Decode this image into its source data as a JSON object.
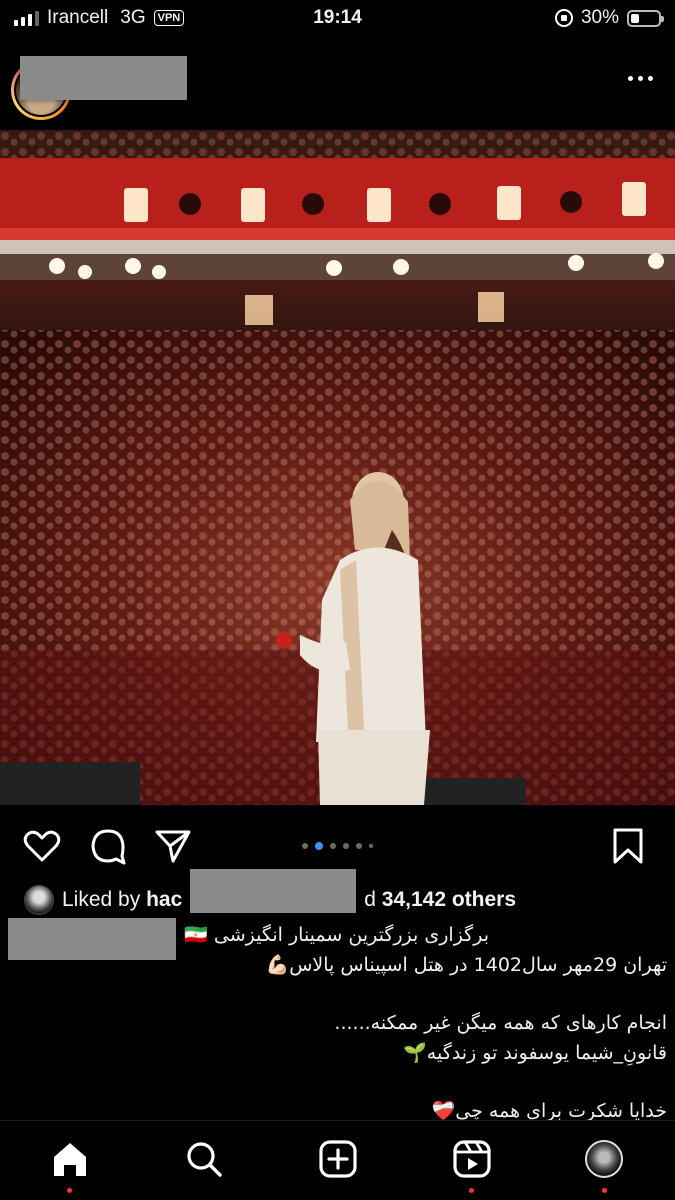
{
  "status_bar": {
    "carrier": "Irancell",
    "network": "3G",
    "vpn": "VPN",
    "time": "19:14",
    "battery": "30%",
    "battery_level": 0.3
  },
  "post": {
    "more_icon": "more-horizontal-icon",
    "carousel": {
      "count": 6,
      "active_index": 0
    },
    "likes": {
      "prefix": "Liked by",
      "user_visible": "hac",
      "suffix_visible": "d",
      "count_text": "34,142 others"
    },
    "caption": {
      "line1": "برگزاری بزرگترین سمینار انگیزشی 🇮🇷",
      "line2": "تهران 29مهر سال1402 در هتل اسپیناس پالاس💪🏻",
      "line3": "انجام کارهای که همه میگن غیر ممکنه......",
      "line4": "قانونِ_شیما یوسفوند تو زندگیه🌱",
      "line5": "خدایا شکرت برای همه چی❤️‍🩹"
    }
  },
  "icons": {
    "like": "heart-icon",
    "comment": "comment-icon",
    "share": "send-icon",
    "save": "bookmark-icon"
  },
  "tabbar": {
    "items": [
      "home-icon",
      "search-icon",
      "create-icon",
      "reels-icon",
      "profile-icon"
    ]
  },
  "colors": {
    "active_dot": "#3897f0",
    "notification_dot": "#ff3040"
  }
}
